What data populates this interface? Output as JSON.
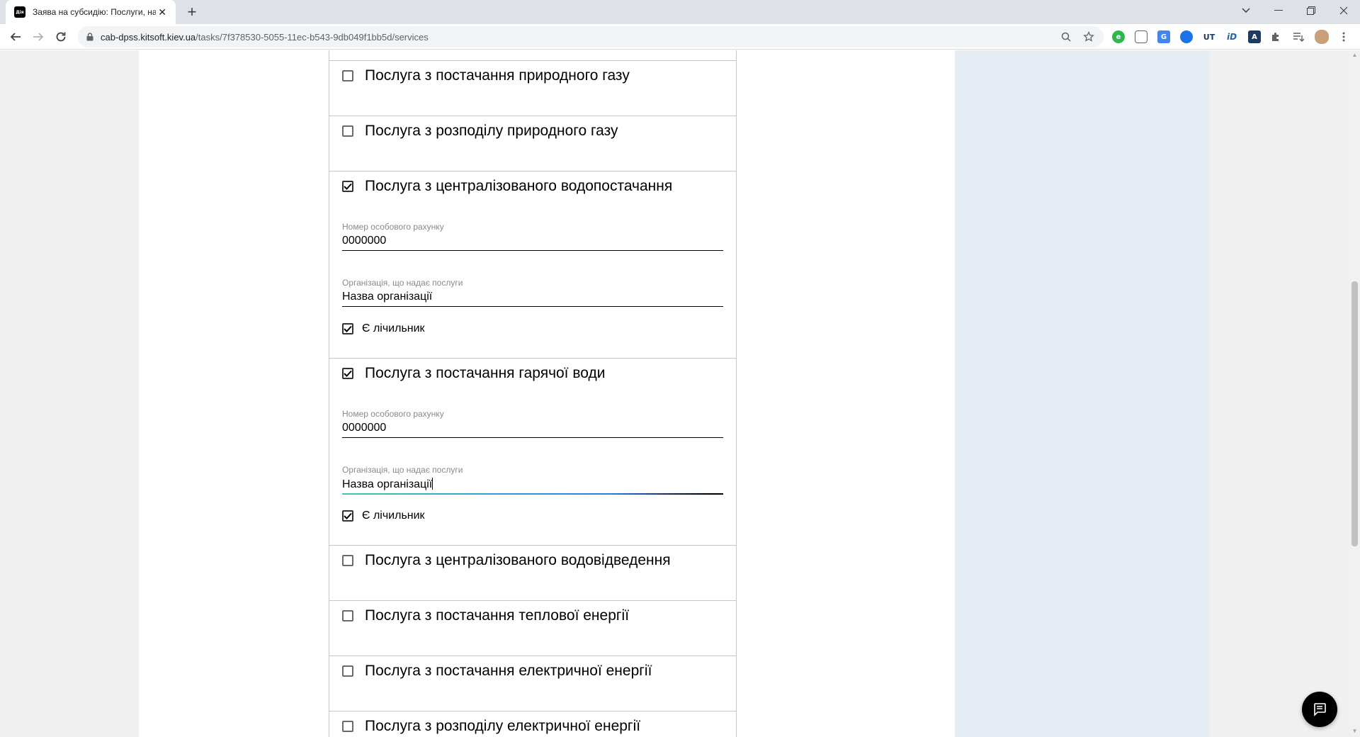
{
  "browser": {
    "tab_title": "Заява на субсидію: Послуги, на",
    "favicon_text": "Дія",
    "url_host": "cab-dpss.kitsoft.kiev.ua",
    "url_path": "/tasks/7f378530-5055-11ec-b543-9db049f1bb5d/services"
  },
  "services": [
    {
      "title": "Послуга з постачання природного газу",
      "checked": false
    },
    {
      "title": "Послуга з розподілу природного газу",
      "checked": false
    },
    {
      "title": "Послуга з централізованого водопостачання",
      "checked": true,
      "account_label": "Номер особового рахунку",
      "account_value": "0000000",
      "org_label": "Організація, що надає послуги",
      "org_value": "Назва організації",
      "meter_label": "Є лічильник",
      "meter_checked": true
    },
    {
      "title": "Послуга з постачання гарячої води",
      "checked": true,
      "account_label": "Номер особового рахунку",
      "account_value": "0000000",
      "org_label": "Організація, що надає послуги",
      "org_value": "Назва організації",
      "meter_label": "Є лічильник",
      "meter_checked": true
    },
    {
      "title": "Послуга з централізованого водовідведення",
      "checked": false
    },
    {
      "title": "Послуга з постачання теплової енергії",
      "checked": false
    },
    {
      "title": "Послуга з постачання електричної енергії",
      "checked": false
    },
    {
      "title": "Послуга з розподілу електричної енергії",
      "checked": false
    }
  ]
}
